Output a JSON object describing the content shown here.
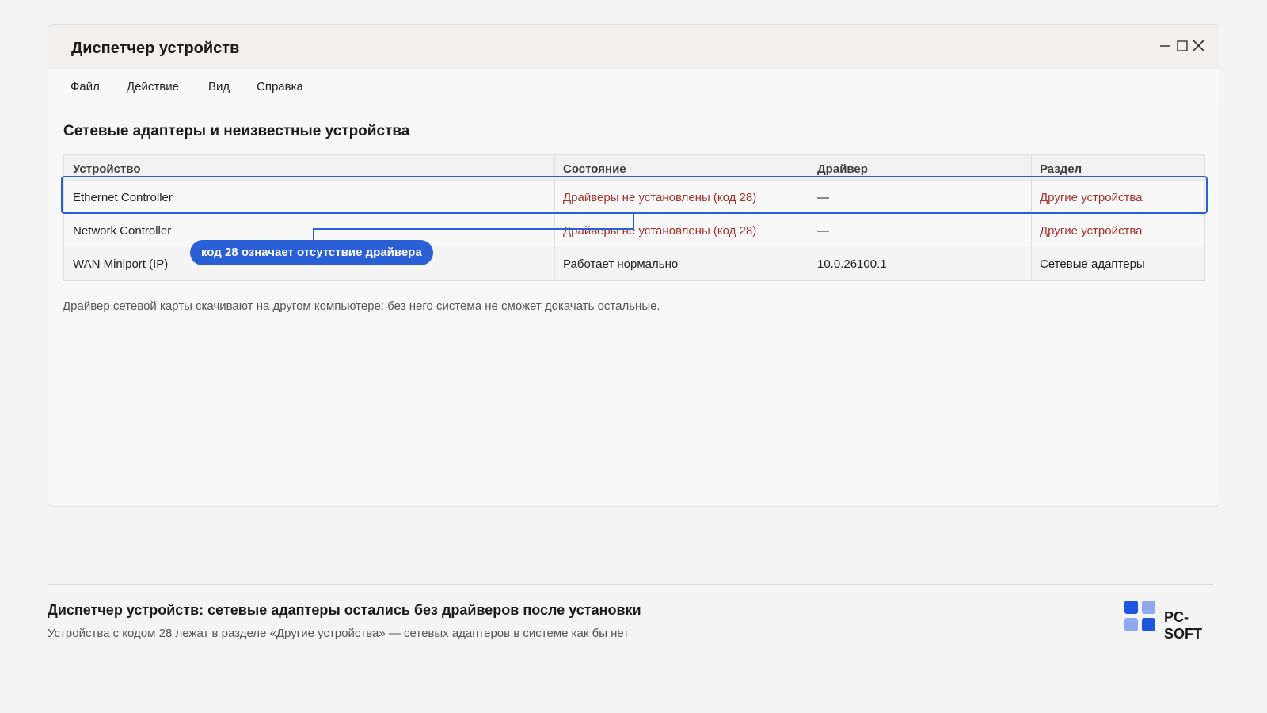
{
  "window": {
    "title": "Диспетчер устройств",
    "controls": {
      "minimize_icon": "minimize-icon",
      "maximize_icon": "maximize-icon",
      "close_icon": "close-icon"
    }
  },
  "menu": {
    "items": [
      {
        "label": "Файл"
      },
      {
        "label": "Действие"
      },
      {
        "label": "Вид"
      },
      {
        "label": "Справка"
      }
    ]
  },
  "main": {
    "section_title": "Сетевые адаптеры и неизвестные устройства",
    "table": {
      "headers": [
        "Устройство",
        "Состояние",
        "Драйвер",
        "Раздел"
      ],
      "rows": [
        {
          "device": "Ethernet Controller",
          "status": "Драйверы не установлены (код 28)",
          "driver": "—",
          "category": "Другие устройства",
          "highlighted": true
        },
        {
          "device": "Network Controller",
          "status": "Драйверы не установлены (код 28)",
          "driver": "—",
          "category": "Другие устройства"
        },
        {
          "device": "WAN Miniport (IP)",
          "status": "Работает нормально",
          "driver": "10.0.26100.1",
          "category": "Сетевые адаптеры"
        }
      ]
    },
    "callout": "код 28 означает отсутствие драйвера",
    "note": "Драйвер сетевой карты скачивают на другом компьютере: без него система не сможет докачать остальные."
  },
  "footer": {
    "title": "Диспетчер устройств: сетевые адаптеры остались без драйверов после установки",
    "subtitle": "Устройства с кодом 28 лежат в разделе «Другие устройства» — сетевых адаптеров в системе как бы нет",
    "brand": "PC-SOFT"
  },
  "colors": {
    "accent": "#2a5fd6",
    "error_text": "#a3312b",
    "brand_dark": "#1f56e0",
    "brand_light": "#8fa9ee"
  }
}
